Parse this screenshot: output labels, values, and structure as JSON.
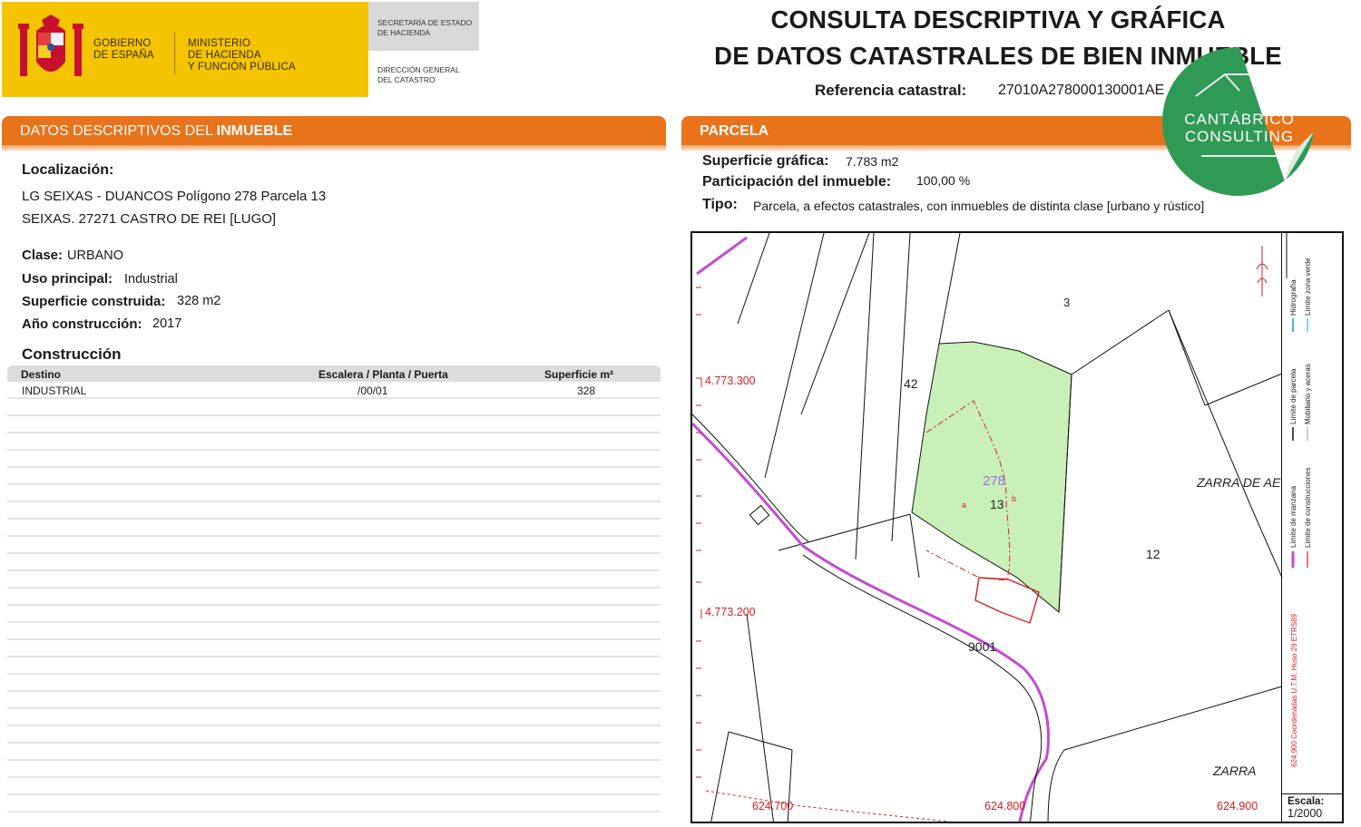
{
  "header": {
    "gov_line1": "GOBIERNO",
    "gov_line2": "DE ESPAÑA",
    "ministry_line1": "MINISTERIO",
    "ministry_line2": "DE HACIENDA",
    "ministry_line3": "Y FUNCIÓN PÚBLICA",
    "secretaria_line1": "SECRETARÍA DE ESTADO",
    "secretaria_line2": "DE HACIENDA",
    "direccion_line1": "DIRECCIÓN GENERAL",
    "direccion_line2": "DEL CATASTRO",
    "title_line1": "CONSULTA DESCRIPTIVA Y GRÁFICA",
    "title_line2": "DE DATOS CATASTRALES DE BIEN INMUEBLE",
    "ref_label": "Referencia catastral:",
    "ref_value": "27010A278000130001AE"
  },
  "left": {
    "section_title_prefix": "DATOS DESCRIPTIVOS DEL ",
    "section_title_bold": "INMUEBLE",
    "localizacion_label": "Localización:",
    "address_line1": "LG SEIXAS - DUANCOS  Polígono 278 Parcela 13",
    "address_line2": "SEIXAS. 27271 CASTRO DE REI [LUGO]",
    "clase_label": "Clase:",
    "clase_value": "URBANO",
    "uso_label": "Uso principal:",
    "uso_value": "Industrial",
    "superficie_label": "Superficie construida:",
    "superficie_value": "328 m2",
    "anio_label": "Año construcción:",
    "anio_value": "2017",
    "construccion_title": "Construcción",
    "table": {
      "headers": [
        "Destino",
        "Escalera / Planta / Puerta",
        "Superficie m²"
      ],
      "rows": [
        [
          "INDUSTRIAL",
          "/00/01",
          "328"
        ]
      ]
    }
  },
  "right": {
    "section_title": "PARCELA",
    "sup_label": "Superficie gráfica:",
    "sup_value": "7.783 m2",
    "part_label": "Participación del inmueble:",
    "part_value": "100,00 %",
    "tipo_label": "Tipo:",
    "tipo_value": "Parcela, a efectos catastrales, con inmuebles de distinta clase [urbano y rústico]"
  },
  "map": {
    "parcel_labels": [
      "3",
      "42",
      "278",
      "13",
      "a",
      "b",
      "12",
      "9001",
      "ZARRA DE AE",
      "ZARRA"
    ],
    "coord_y1": "4.773.300",
    "coord_y2": "4.773.200",
    "coord_x1": "624.700",
    "coord_x2": "624.800",
    "coord_x3": "624.900",
    "legend_1a": "Hidrografía",
    "legend_1b": "Límite zona verde",
    "legend_2a": "Límite de parcela",
    "legend_2b": "Mobiliario y aceras",
    "legend_3a": "Límite de manzana",
    "legend_3b": "Límite de construcciones",
    "legend_coords": "624,900 Coordenadas U.T.M. Huso 29 ETRS89",
    "scale_label": "Escala:",
    "scale_value": "1/2000",
    "colors": {
      "parcel_fill": "#c8f0b8",
      "road": "#c24dd0",
      "building": "#d62020"
    }
  },
  "watermark": {
    "line1": "CANTÁBRICO",
    "line2": "CONSULTING"
  }
}
